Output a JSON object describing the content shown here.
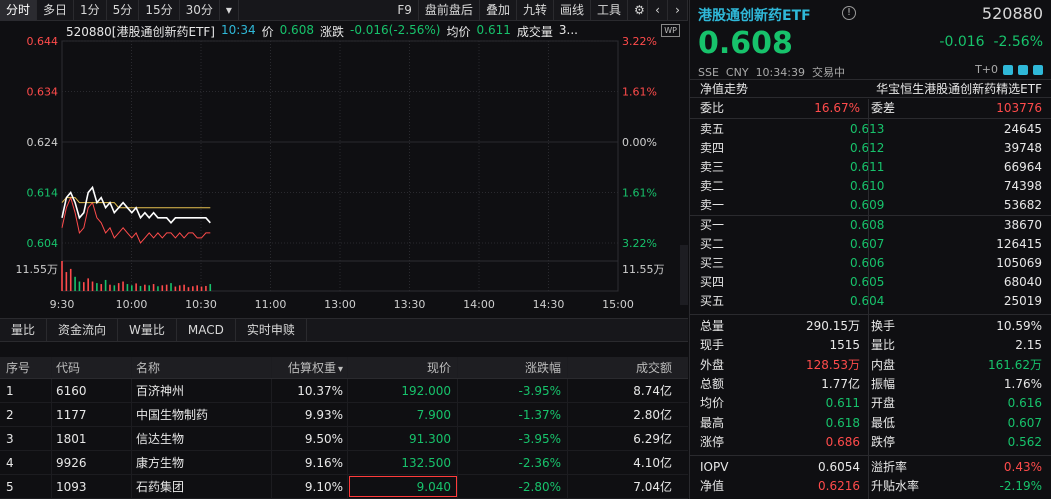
{
  "toolbar": {
    "tabs": [
      "分时",
      "多日",
      "1分",
      "5分",
      "15分",
      "30分",
      "▾"
    ],
    "tools": [
      "F9",
      "盘前盘后",
      "叠加",
      "九转",
      "画线",
      "工具"
    ]
  },
  "chart": {
    "header": {
      "symbol": "520880[港股通创新药ETF]",
      "time": "10:34",
      "price_label": "价",
      "price": "0.608",
      "chg_label": "涨跌",
      "chg": "-0.016(-2.56%)",
      "avg_label": "均价",
      "avg": "0.611",
      "vol_label": "成交量",
      "vol": "3..."
    },
    "badge": "WP",
    "y_left": [
      "0.644",
      "0.634",
      "0.624",
      "0.614",
      "0.604"
    ],
    "y_right": [
      "3.22%",
      "1.61%",
      "0.00%",
      "1.61%",
      "3.22%"
    ],
    "vol_left": "11.55万",
    "vol_right": "11.55万",
    "x_labels": [
      "9:30",
      "10:00",
      "10:30",
      "11:00",
      "13:00",
      "13:30",
      "14:00",
      "14:30",
      "15:00"
    ]
  },
  "chart_data": {
    "type": "line",
    "title": "",
    "x_categories": [
      "9:30",
      "10:00",
      "10:30",
      "11:00",
      "13:00",
      "13:30",
      "14:00",
      "14:30",
      "15:00"
    ],
    "ylim": [
      0.604,
      0.644
    ],
    "y_ref": 0.624,
    "grid": true,
    "series": [
      {
        "name": "价",
        "color": "#ffffff",
        "values": [
          0.609,
          0.613,
          0.614,
          0.612,
          0.609,
          0.61,
          0.614,
          0.615,
          0.612,
          0.613,
          0.611,
          0.612,
          0.61,
          0.611,
          0.612,
          0.611,
          0.61,
          0.611,
          0.609,
          0.61,
          0.609,
          0.61,
          0.609,
          0.609,
          0.609,
          0.608,
          0.609,
          0.609,
          0.609,
          0.609,
          0.609,
          0.609,
          0.609,
          0.609,
          0.608
        ]
      },
      {
        "name": "均价",
        "color": "#e5c150",
        "values": [
          0.612,
          0.613,
          0.613,
          0.613,
          0.612,
          0.612,
          0.612,
          0.612,
          0.612,
          0.612,
          0.612,
          0.612,
          0.612,
          0.611,
          0.611,
          0.611,
          0.611,
          0.611,
          0.611,
          0.611,
          0.611,
          0.611,
          0.611,
          0.611,
          0.611,
          0.611,
          0.611,
          0.611,
          0.611,
          0.611,
          0.611,
          0.611,
          0.611,
          0.611,
          0.611
        ]
      },
      {
        "name": "IOPV",
        "color": "#ff4b4b",
        "values": [
          0.607,
          0.611,
          0.613,
          0.61,
          0.606,
          0.607,
          0.611,
          0.612,
          0.609,
          0.608,
          0.606,
          0.607,
          0.605,
          0.606,
          0.607,
          0.606,
          0.605,
          0.606,
          0.604,
          0.605,
          0.606,
          0.605,
          0.606,
          0.605,
          0.606,
          0.606,
          0.605,
          0.606,
          0.605,
          0.606,
          0.606,
          0.605,
          0.605,
          0.606,
          0.606
        ]
      }
    ],
    "volume": [
      95,
      60,
      70,
      45,
      30,
      28,
      40,
      30,
      25,
      22,
      35,
      20,
      18,
      25,
      30,
      22,
      18,
      24,
      16,
      20,
      18,
      22,
      15,
      18,
      20,
      25,
      14,
      18,
      20,
      12,
      15,
      18,
      14,
      16,
      22
    ]
  },
  "indicator_tabs": [
    "量比",
    "资金流向",
    "W量比",
    "MACD",
    "实时申赎"
  ],
  "holdings": {
    "headers": [
      "序号",
      "代码",
      "名称",
      "估算权重",
      "现价",
      "涨跌幅",
      "成交额"
    ],
    "sort_marker": "▾",
    "rows": [
      {
        "seq": "1",
        "code": "6160",
        "name": "百济神州",
        "weight": "10.37%",
        "price": "192.000",
        "chg": "-3.95%",
        "amount": "8.74亿"
      },
      {
        "seq": "2",
        "code": "1177",
        "name": "中国生物制药",
        "weight": "9.93%",
        "price": "7.900",
        "chg": "-1.37%",
        "amount": "2.80亿"
      },
      {
        "seq": "3",
        "code": "1801",
        "name": "信达生物",
        "weight": "9.50%",
        "price": "91.300",
        "chg": "-3.95%",
        "amount": "6.29亿"
      },
      {
        "seq": "4",
        "code": "9926",
        "name": "康方生物",
        "weight": "9.16%",
        "price": "132.500",
        "chg": "-2.36%",
        "amount": "4.10亿"
      },
      {
        "seq": "5",
        "code": "1093",
        "name": "石药集团",
        "weight": "9.10%",
        "price": "9.040",
        "chg": "-2.80%",
        "amount": "7.04亿"
      }
    ]
  },
  "quote": {
    "title": "港股通创新药ETF",
    "info_icon": "!",
    "code": "520880",
    "price": "0.608",
    "change": "-0.016",
    "change_pct": "-2.56%",
    "exchange": "SSE",
    "currency": "CNY",
    "time": "10:34:39",
    "status": "交易中",
    "t_flag": "T+0",
    "nav_trend_label": "净值走势",
    "fund_name": "华宝恒生港股通创新药精选ETF",
    "weibi_label": "委比",
    "weibi": "16.67%",
    "weicha_label": "委差",
    "weicha": "103776",
    "asks": [
      {
        "label": "卖五",
        "price": "0.613",
        "vol": "24645"
      },
      {
        "label": "卖四",
        "price": "0.612",
        "vol": "39748"
      },
      {
        "label": "卖三",
        "price": "0.611",
        "vol": "66964"
      },
      {
        "label": "卖二",
        "price": "0.610",
        "vol": "74398"
      },
      {
        "label": "卖一",
        "price": "0.609",
        "vol": "53682"
      }
    ],
    "bids": [
      {
        "label": "买一",
        "price": "0.608",
        "vol": "38670"
      },
      {
        "label": "买二",
        "price": "0.607",
        "vol": "126415"
      },
      {
        "label": "买三",
        "price": "0.606",
        "vol": "105069"
      },
      {
        "label": "买四",
        "price": "0.605",
        "vol": "68040"
      },
      {
        "label": "买五",
        "price": "0.604",
        "vol": "25019"
      }
    ],
    "stats": [
      {
        "l1": "总量",
        "v1": "290.15万",
        "c1": "wt",
        "l2": "换手",
        "v2": "10.59%",
        "c2": "wt"
      },
      {
        "l1": "现手",
        "v1": "1515",
        "c1": "wt",
        "l2": "量比",
        "v2": "2.15",
        "c2": "wt"
      },
      {
        "l1": "外盘",
        "v1": "128.53万",
        "c1": "up",
        "l2": "内盘",
        "v2": "161.62万",
        "c2": "dn"
      },
      {
        "l1": "总额",
        "v1": "1.77亿",
        "c1": "wt",
        "l2": "振幅",
        "v2": "1.76%",
        "c2": "wt"
      },
      {
        "l1": "均价",
        "v1": "0.611",
        "c1": "dn",
        "l2": "开盘",
        "v2": "0.616",
        "c2": "dn"
      },
      {
        "l1": "最高",
        "v1": "0.618",
        "c1": "dn",
        "l2": "最低",
        "v2": "0.607",
        "c2": "dn"
      },
      {
        "l1": "涨停",
        "v1": "0.686",
        "c1": "up",
        "l2": "跌停",
        "v2": "0.562",
        "c2": "dn"
      },
      {
        "l1": "IOPV",
        "v1": "0.6054",
        "c1": "wt",
        "l2": "溢折率",
        "v2": "0.43%",
        "c2": "up"
      },
      {
        "l1": "净值",
        "v1": "0.6216",
        "c1": "up",
        "l2": "升贴水率",
        "v2": "-2.19%",
        "c2": "dn"
      }
    ]
  }
}
